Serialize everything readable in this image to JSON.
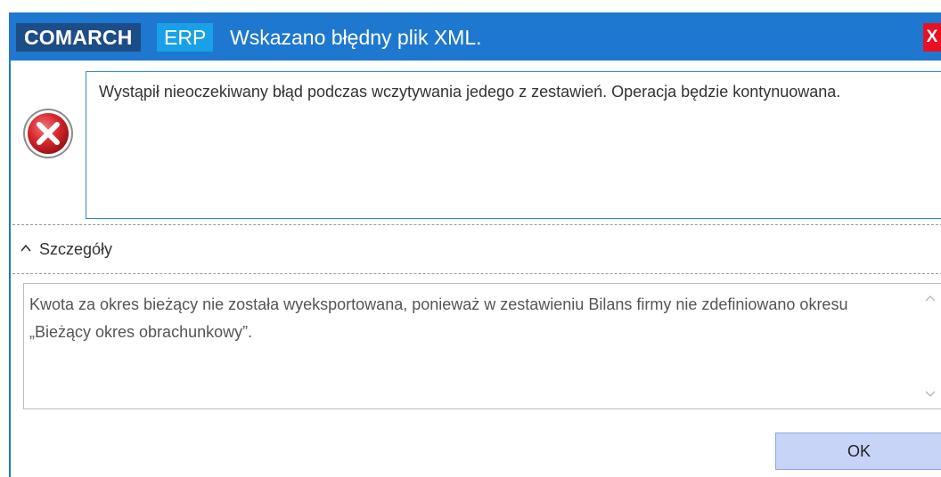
{
  "window": {
    "brand_primary": "COMARCH",
    "brand_secondary": "ERP",
    "title": "Wskazano błędny plik XML.",
    "close_label": "X"
  },
  "message": {
    "icon": "error-icon",
    "text": "Wystąpił nieoczekiwany błąd podczas wczytywania jedego z zestawień. Operacja będzie kontynuowana."
  },
  "details": {
    "toggle_label": "Szczegóły",
    "text": "Kwota za okres bieżący nie została wyeksportowana, ponieważ w zestawieniu Bilans firmy nie zdefiniowano okresu „Bieżący okres obrachunkowy”."
  },
  "buttons": {
    "ok_label": "OK"
  },
  "colors": {
    "titlebar": "#1e78d0",
    "brand_primary_bg": "#1d4d86",
    "brand_secondary_bg": "#1aa0e6",
    "close_bg": "#e81123",
    "ok_bg": "#c7d4f7",
    "error_red": "#d9272e"
  }
}
